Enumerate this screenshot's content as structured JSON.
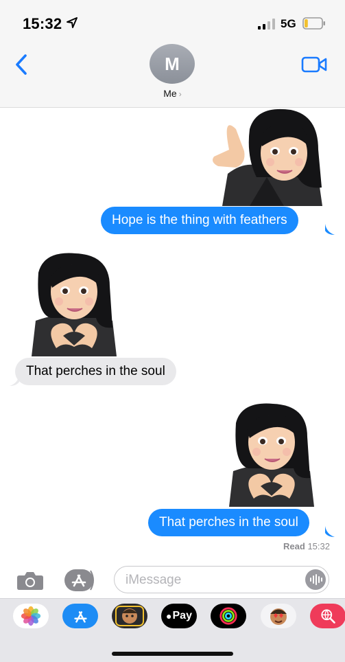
{
  "status_bar": {
    "time": "15:32",
    "network": "5G",
    "location_icon": "location-arrow-icon",
    "battery_level": 0.2
  },
  "header": {
    "avatar_initial": "M",
    "contact_name": "Me",
    "contact_chevron": "›"
  },
  "messages": [
    {
      "direction": "outgoing",
      "sticker": "memoji-call-me",
      "text": "Hope is the thing with feathers"
    },
    {
      "direction": "incoming",
      "sticker": "memoji-heart-hands",
      "text": "That perches in the soul"
    },
    {
      "direction": "outgoing",
      "sticker": "memoji-heart-hands",
      "text": "That perches in the soul"
    }
  ],
  "receipt": {
    "label": "Read",
    "time": "15:32"
  },
  "composer": {
    "placeholder": "iMessage"
  },
  "app_drawer": {
    "apps": [
      "photos-app",
      "app-store-app",
      "memoji-stickers-app",
      "apple-pay-app",
      "activity-app",
      "animoji-app",
      "search-web-images-app"
    ],
    "apple_pay_label": "Pay"
  },
  "colors": {
    "outgoing_bubble": "#1a8bff",
    "incoming_bubble": "#e9e9eb",
    "accent": "#1a7bff"
  }
}
